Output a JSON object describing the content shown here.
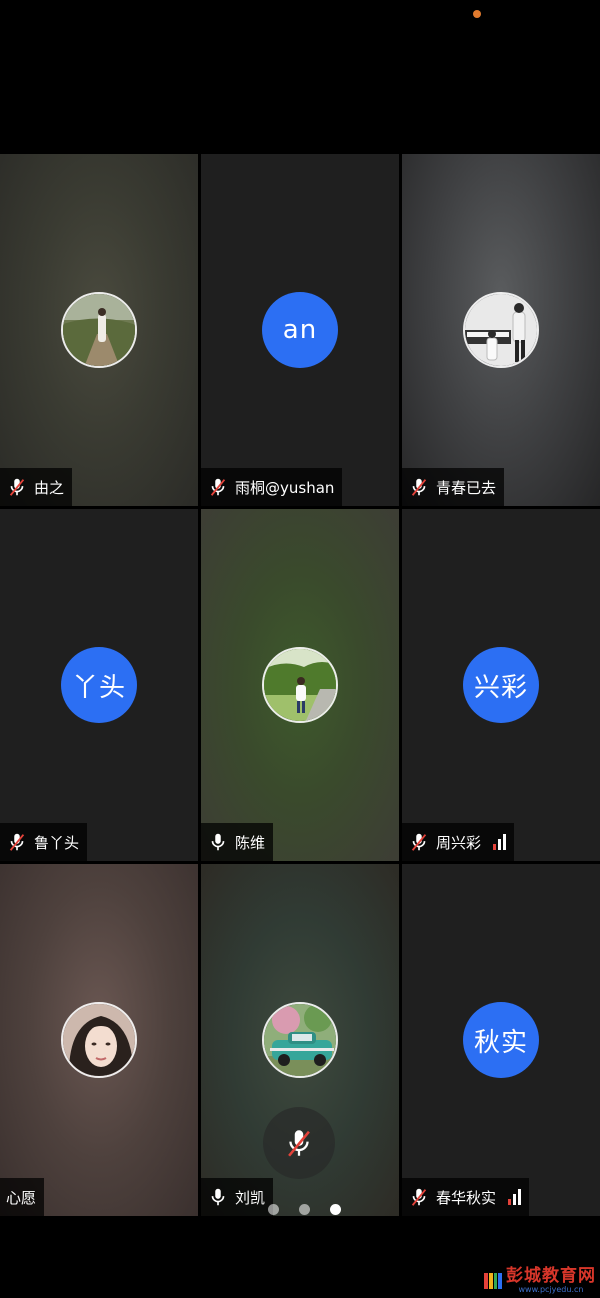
{
  "participants": [
    {
      "name": "由之",
      "mic": "muted",
      "avatar_type": "photo",
      "photo": "woman-on-steps"
    },
    {
      "name": "雨桐@yushan",
      "mic": "muted",
      "avatar_type": "initials",
      "initials": "an"
    },
    {
      "name": "青春已去",
      "mic": "muted",
      "avatar_type": "photo",
      "photo": "people-at-piano"
    },
    {
      "name": "鲁丫头",
      "mic": "muted",
      "avatar_type": "initials",
      "initials": "丫头"
    },
    {
      "name": "陈维",
      "mic": "on",
      "avatar_type": "photo",
      "photo": "child-on-path"
    },
    {
      "name": "周兴彩",
      "mic": "muted",
      "avatar_type": "initials",
      "initials": "兴彩",
      "signal": "weak"
    },
    {
      "name": "心愿",
      "mic": "none",
      "avatar_type": "photo",
      "photo": "woman-portrait"
    },
    {
      "name": "刘凯",
      "mic": "on",
      "avatar_type": "photo",
      "photo": "vintage-car"
    },
    {
      "name": "春华秋实",
      "mic": "muted",
      "avatar_type": "initials",
      "initials": "秋实",
      "signal": "weak"
    }
  ],
  "controls": {
    "mute_icon": "mic-muted-icon"
  },
  "pager": {
    "pages": 3,
    "current": 3
  },
  "colors": {
    "initials_bg": "#2c6ff3",
    "muted_slash": "#e4423a",
    "status_dot": "#e07a2e"
  },
  "watermark": {
    "title": "彭城教育网",
    "url": "www.pcjyedu.cn"
  }
}
